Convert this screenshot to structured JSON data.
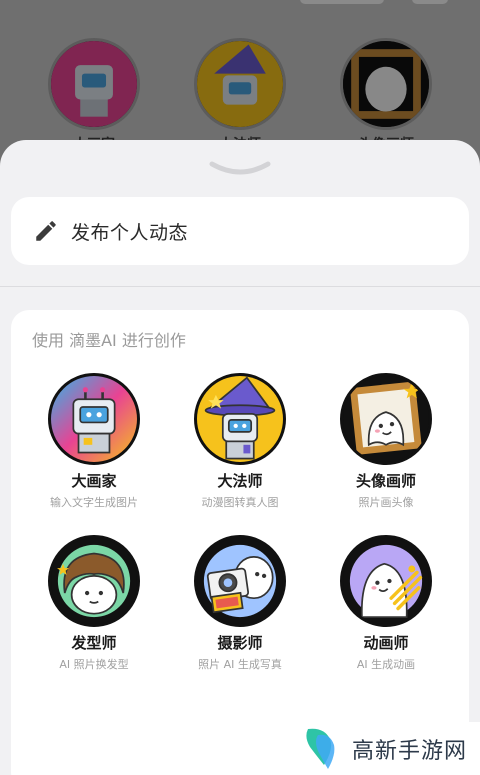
{
  "background": {
    "labels": [
      "大画家",
      "大法师",
      "头像画师"
    ]
  },
  "post": {
    "label": "发布个人动态",
    "icon": "pencil-icon"
  },
  "section": {
    "title": "使用 滴墨AI 进行创作"
  },
  "tools": [
    {
      "name": "大画家",
      "desc": "输入文字生成图片",
      "icon": "robot-painter-icon"
    },
    {
      "name": "大法师",
      "desc": "动漫图转真人图",
      "icon": "robot-wizard-icon"
    },
    {
      "name": "头像画师",
      "desc": "照片画头像",
      "icon": "ghost-frame-icon"
    },
    {
      "name": "发型师",
      "desc": "AI 照片换发型",
      "icon": "curly-hair-icon"
    },
    {
      "name": "摄影师",
      "desc": "照片 AI 生成写真",
      "icon": "camera-ghost-icon"
    },
    {
      "name": "动画师",
      "desc": "AI 生成动画",
      "icon": "ghost-animator-icon"
    }
  ],
  "watermark": {
    "text": "高新手游网"
  },
  "colors": {
    "sheet": "#f1f1f3",
    "card": "#ffffff",
    "accent_yellow": "#f6c21c",
    "accent_purple": "#6a5acd"
  }
}
